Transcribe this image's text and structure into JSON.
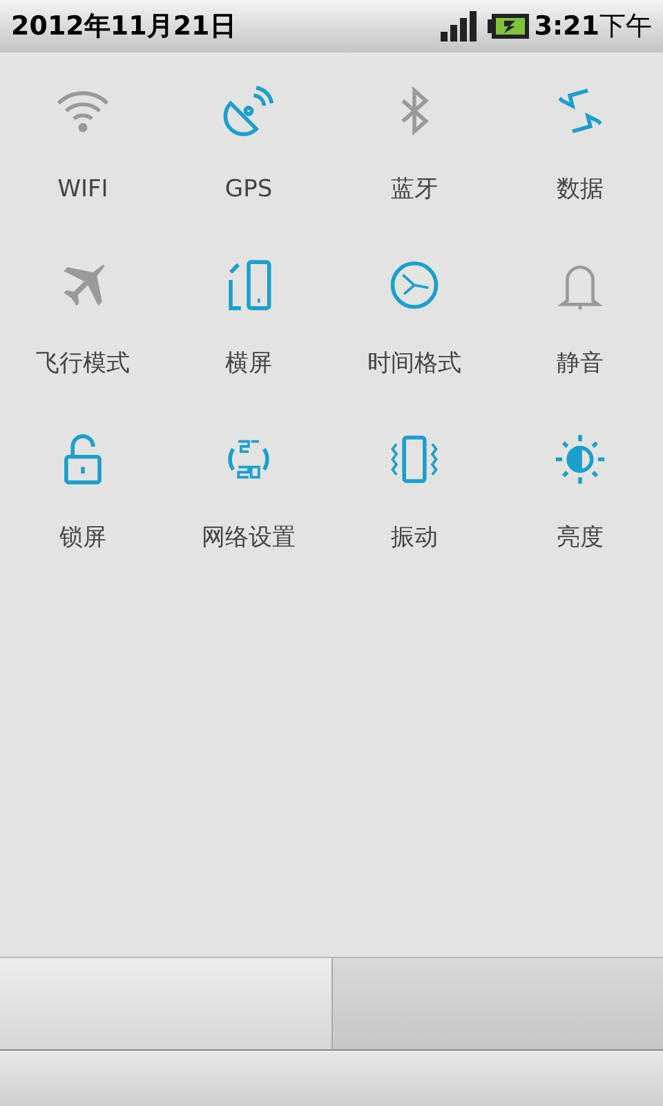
{
  "status_bar": {
    "date": "2012年11月21日",
    "time": "3:21",
    "period": "下午"
  },
  "toggles": [
    {
      "kind": "wifi",
      "label": "WIFI",
      "on": false
    },
    {
      "kind": "gps",
      "label": "GPS",
      "on": true
    },
    {
      "kind": "bluetooth",
      "label": "蓝牙",
      "on": false
    },
    {
      "kind": "data",
      "label": "数据",
      "on": true
    },
    {
      "kind": "airplane",
      "label": "飞行模式",
      "on": false
    },
    {
      "kind": "rotate",
      "label": "横屏",
      "on": true
    },
    {
      "kind": "clock",
      "label": "时间格式",
      "on": true
    },
    {
      "kind": "silent",
      "label": "静音",
      "on": false
    },
    {
      "kind": "lock",
      "label": "锁屏",
      "on": true
    },
    {
      "kind": "network",
      "label": "网络设置",
      "on": true
    },
    {
      "kind": "vibrate",
      "label": "振动",
      "on": true
    },
    {
      "kind": "brightness",
      "label": "亮度",
      "on": true
    }
  ],
  "bottom_tabs": [
    {
      "selected": true
    },
    {
      "selected": false
    }
  ]
}
